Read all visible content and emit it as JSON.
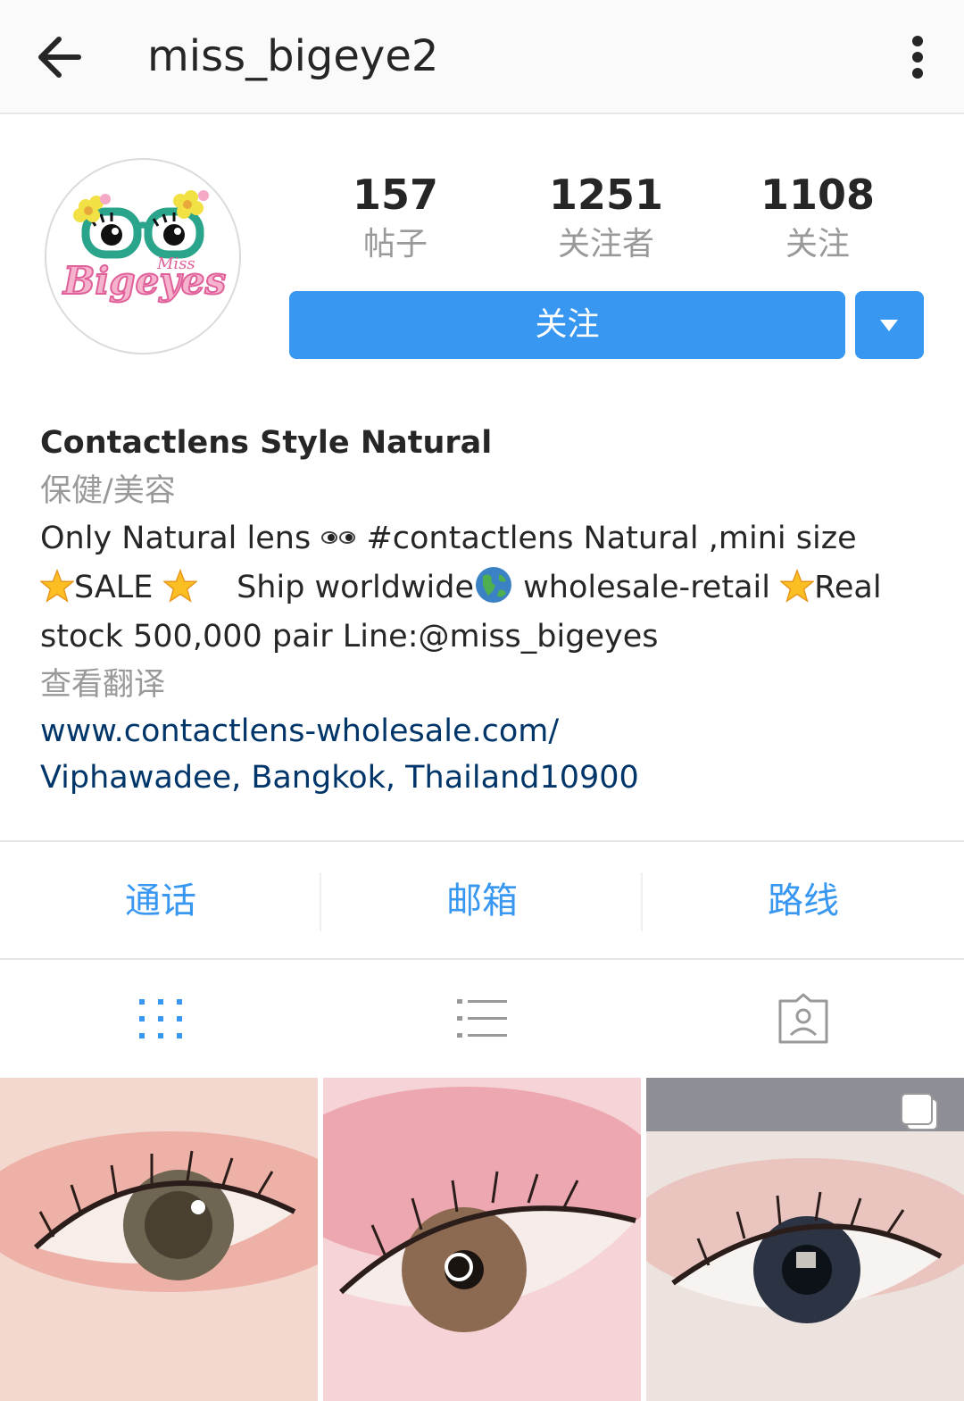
{
  "header": {
    "username": "miss_bigeye2",
    "back_icon": "back-arrow-icon",
    "menu_icon": "more-vertical-icon"
  },
  "profile": {
    "avatar_logo_text": "Miss Bigeyes",
    "stats": {
      "posts": {
        "value": "157",
        "label": "帖子"
      },
      "followers": {
        "value": "1251",
        "label": "关注者"
      },
      "following": {
        "value": "1108",
        "label": "关注"
      }
    },
    "follow_label": "关注"
  },
  "bio": {
    "name": "Contactlens Style Natural",
    "category": "保健/美容",
    "line1_a": "Only Natural lens ",
    "line1_b": " #contactlens Natural ,mini size",
    "line2_a": "SALE ",
    "line2_b": "Ship worldwide",
    "line2_c": " wholesale-retail ",
    "line2_d": "Real",
    "line3": "stock 500,000 pair Line:@miss_bigeyes",
    "translate": "查看翻译",
    "website": "www.contactlens-wholesale.com/",
    "address": "Viphawadee, Bangkok, Thailand10900"
  },
  "contact": {
    "call": "通话",
    "email": "邮箱",
    "directions": "路线"
  },
  "tabs": {
    "grid": "grid-icon",
    "list": "list-icon",
    "tagged": "tagged-icon"
  },
  "colors": {
    "accent": "#3897f0",
    "link": "#003569",
    "muted": "#999999"
  }
}
